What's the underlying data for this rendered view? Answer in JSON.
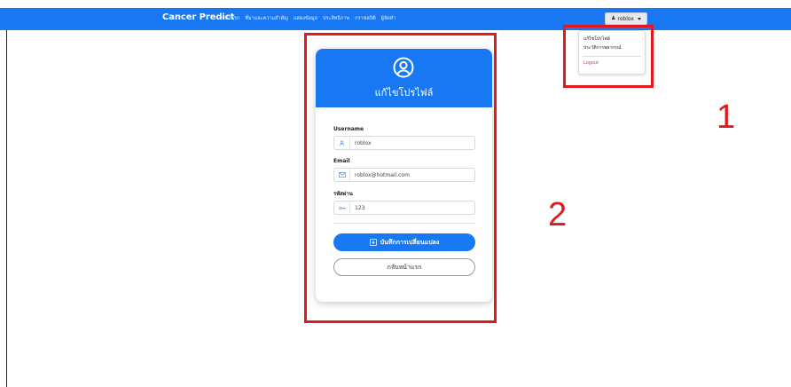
{
  "navbar": {
    "brand": "Cancer Predict",
    "links": [
      "หน้าแรก",
      "ที่มาและความสำคัญ",
      "แสดงข้อมูล",
      "ประสิทธิภาพ",
      "กราฟสถิติ",
      "ผู้จัดทำ"
    ],
    "user_label": "roblox",
    "user_icon": "user-icon",
    "background_color": "#1877f2"
  },
  "dropdown": {
    "items": [
      "แก้ไขโปรไฟล์",
      "ประวัติการพยากรณ์"
    ],
    "logout_label": "Logout",
    "logout_color": "#dc3545"
  },
  "annotations": {
    "label_1": "1",
    "label_2": "2",
    "color": "#e0191f"
  },
  "card": {
    "header_icon": "user-circle-icon",
    "title": "แก้ไขโปรไฟล์",
    "fields": {
      "username": {
        "label": "Username",
        "value": "roblox",
        "icon": "user-icon"
      },
      "email": {
        "label": "Email",
        "value": "roblox@hotmail.com",
        "icon": "envelope-icon"
      },
      "password": {
        "label": "รหัสผ่าน",
        "value": "123",
        "icon": "key-icon"
      }
    },
    "save_button": {
      "label": "บันทึกการเปลี่ยนแปลง",
      "icon": "save-icon"
    },
    "back_button": {
      "label": "กลับหน้าแรก"
    },
    "accent_color": "#1877f2"
  }
}
